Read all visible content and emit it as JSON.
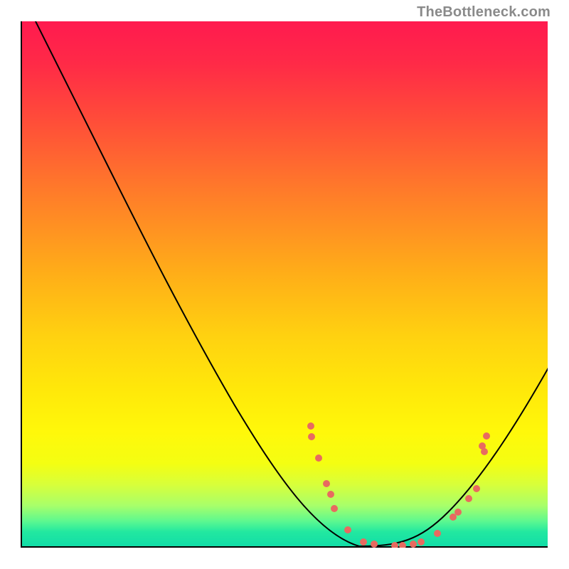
{
  "watermark": "TheBottleneck.com",
  "chart_data": {
    "type": "line",
    "title": "",
    "xlabel": "",
    "ylabel": "",
    "xlim": [
      0,
      100
    ],
    "ylim": [
      0,
      100
    ],
    "grid": false,
    "legend_position": null,
    "x": [
      0,
      5,
      10,
      15,
      20,
      25,
      30,
      35,
      40,
      45,
      50,
      55,
      60,
      65,
      70,
      75,
      80,
      85,
      90,
      95,
      100
    ],
    "values": [
      103,
      95,
      86,
      77,
      68,
      59,
      50,
      42,
      34,
      26,
      18,
      11,
      6,
      2,
      0,
      0,
      3,
      8,
      15,
      24,
      35
    ],
    "points_raw": [
      {
        "x": 55,
        "y": 23
      },
      {
        "x": 55,
        "y": 21
      },
      {
        "x": 56.5,
        "y": 17
      },
      {
        "x": 58,
        "y": 12
      },
      {
        "x": 58.8,
        "y": 10
      },
      {
        "x": 59.5,
        "y": 7
      },
      {
        "x": 62,
        "y": 3
      },
      {
        "x": 65,
        "y": 1
      },
      {
        "x": 67,
        "y": 0.5
      },
      {
        "x": 71,
        "y": 0
      },
      {
        "x": 72.5,
        "y": 0
      },
      {
        "x": 74.5,
        "y": 0.5
      },
      {
        "x": 76,
        "y": 1
      },
      {
        "x": 79,
        "y": 2.5
      },
      {
        "x": 82,
        "y": 5.5
      },
      {
        "x": 83,
        "y": 6.5
      },
      {
        "x": 85,
        "y": 9
      },
      {
        "x": 86.5,
        "y": 11
      },
      {
        "x": 87.5,
        "y": 19
      },
      {
        "x": 88,
        "y": 18
      },
      {
        "x": 88.5,
        "y": 21
      }
    ]
  }
}
